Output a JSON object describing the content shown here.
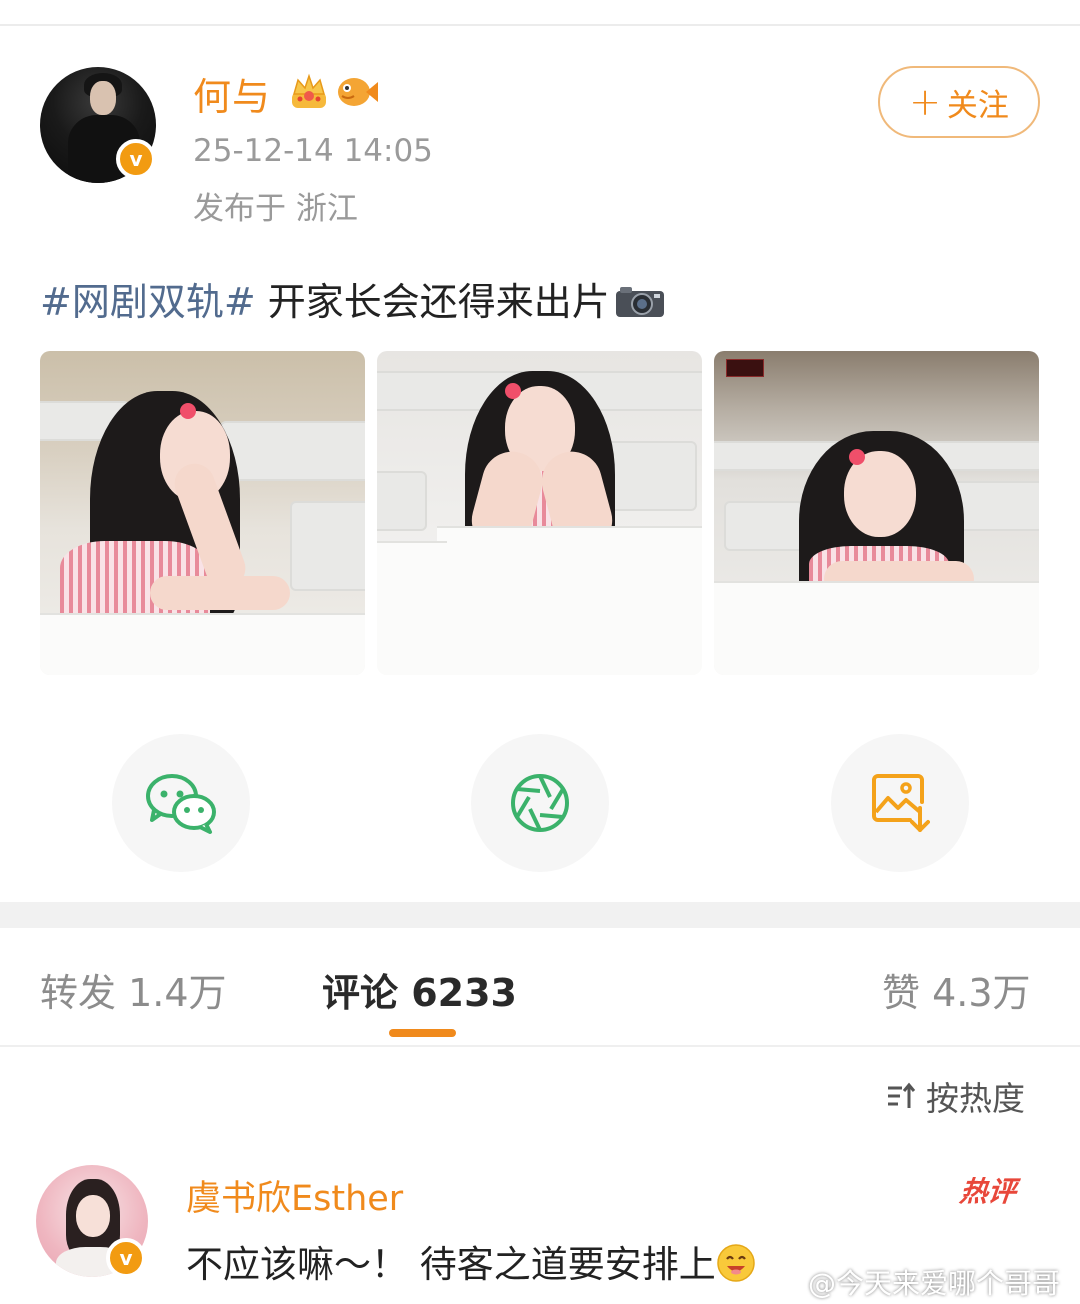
{
  "post": {
    "author": "何与",
    "timestamp": "25-12-14 14:05",
    "location": "发布于 浙江",
    "follow_label": "关注",
    "follow_plus": "+",
    "hashtag": "#网剧双轨#",
    "text": " 开家长会还得来出片",
    "photos": [
      "photo-1",
      "photo-2",
      "photo-3"
    ]
  },
  "share": {
    "items": [
      "wechat-icon",
      "moments-icon",
      "save-image-icon"
    ]
  },
  "tabs": {
    "repost": "转发 1.4万",
    "comments": "评论 6233",
    "likes": "赞 4.3万"
  },
  "sort_label": "按热度",
  "comment": {
    "author": "虞书欣Esther",
    "badge": "热评",
    "text": "不应该嘛～！ 待客之道要安排上"
  },
  "watermark": "@今天来爱哪个哥哥",
  "colors": {
    "accent": "#f08a1c",
    "hashtag": "#526b8e",
    "hot": "#e8473a",
    "wechat_green": "#3bb26b"
  }
}
